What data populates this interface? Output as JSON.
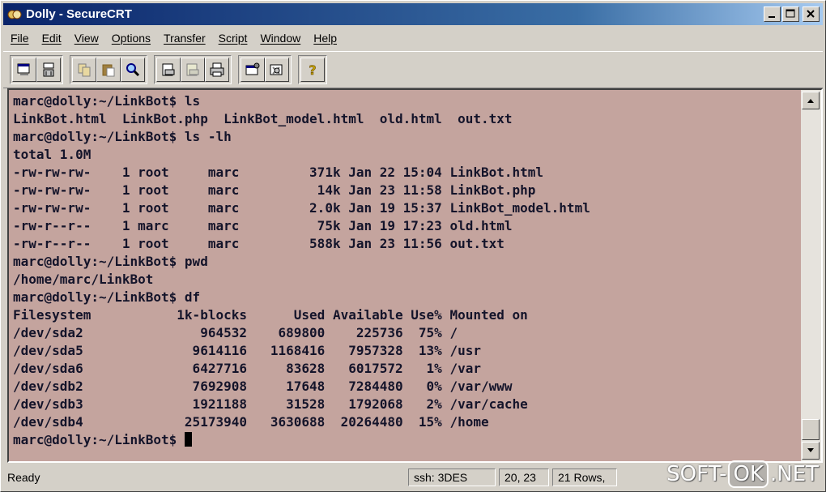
{
  "window": {
    "title": "Dolly - SecureCRT"
  },
  "menu": [
    {
      "label": "File"
    },
    {
      "label": "Edit"
    },
    {
      "label": "View"
    },
    {
      "label": "Options"
    },
    {
      "label": "Transfer"
    },
    {
      "label": "Script"
    },
    {
      "label": "Window"
    },
    {
      "label": "Help"
    }
  ],
  "toolbar": {
    "groups": [
      [
        "connect-icon",
        "quick-connect-icon"
      ],
      [
        "copy-icon",
        "paste-icon",
        "find-icon"
      ],
      [
        "print-setup-icon",
        "print-selection-icon",
        "print-icon"
      ],
      [
        "session-options-icon",
        "global-options-icon"
      ],
      [
        "help-icon"
      ]
    ]
  },
  "terminal": {
    "background": "#c4a49e",
    "lines": [
      "marc@dolly:~/LinkBot$ ls",
      "LinkBot.html  LinkBot.php  LinkBot_model.html  old.html  out.txt",
      "marc@dolly:~/LinkBot$ ls -lh",
      "total 1.0M",
      "-rw-rw-rw-    1 root     marc         371k Jan 22 15:04 LinkBot.html",
      "-rw-rw-rw-    1 root     marc          14k Jan 23 11:58 LinkBot.php",
      "-rw-rw-rw-    1 root     marc         2.0k Jan 19 15:37 LinkBot_model.html",
      "-rw-r--r--    1 marc     marc          75k Jan 19 17:23 old.html",
      "-rw-r--r--    1 root     marc         588k Jan 23 11:56 out.txt",
      "marc@dolly:~/LinkBot$ pwd",
      "/home/marc/LinkBot",
      "marc@dolly:~/LinkBot$ df",
      "Filesystem           1k-blocks      Used Available Use% Mounted on",
      "/dev/sda2               964532    689800    225736  75% /",
      "/dev/sda5              9614116   1168416   7957328  13% /usr",
      "/dev/sda6              6427716     83628   6017572   1% /var",
      "/dev/sdb2              7692908     17648   7284480   0% /var/www",
      "/dev/sdb3              1921188     31528   1792068   2% /var/cache",
      "/dev/sdb4             25173940   3630688  20264480  15% /home"
    ],
    "prompt": "marc@dolly:~/LinkBot$ "
  },
  "status": {
    "ready": "Ready",
    "cipher": "ssh: 3DES",
    "position": "20, 23",
    "rows": "21 Rows,"
  },
  "watermark": {
    "left": "SOFT-",
    "box": "OK",
    "right": ".NET"
  }
}
